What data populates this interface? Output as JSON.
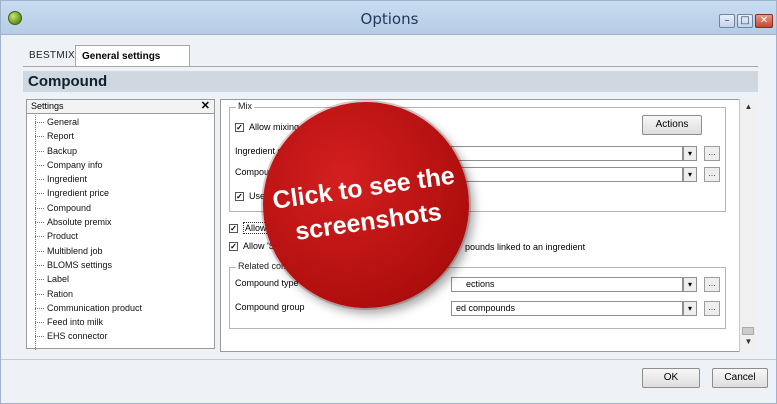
{
  "window": {
    "title": "Options"
  },
  "titlebar_buttons": {
    "minimize": "–",
    "maximize": "□",
    "close": "✕"
  },
  "tabs": [
    {
      "label": "BESTMIX"
    },
    {
      "label": "General settings"
    }
  ],
  "section_title": "Compound",
  "settings": {
    "header": "Settings",
    "close": "✕",
    "items": [
      "General",
      "Report",
      "Backup",
      "Company info",
      "Ingredient",
      "Ingredient price",
      "Compound",
      "Absolute premix",
      "Product",
      "Multiblend job",
      "BLOMS settings",
      "Label",
      "Ration",
      "Communication product",
      "Feed into milk",
      "EHS connector"
    ]
  },
  "mix": {
    "label": "Mix",
    "allow_mixing": "Allow mixing",
    "actions_button": "Actions",
    "ingredient_label": "Ingredient g",
    "compound_label": "Compound",
    "use_label": "Use",
    "combo_arrow": "▾",
    "dots": "..."
  },
  "allow_checkbox_1": "Allow",
  "allow_checkbox_2": "Allow 'S",
  "allow_checkbox_2_tail": "pounds linked to an ingredient",
  "related": {
    "label": "Related com",
    "compound_type_label": "Compound type",
    "compound_type_value": "ections",
    "compound_group_label": "Compound group",
    "compound_group_value": "ed compounds"
  },
  "overlay": {
    "line1": "Click to see the",
    "line2": "screenshots"
  },
  "footer": {
    "ok": "OK",
    "cancel": "Cancel"
  },
  "scrollbar": {
    "up": "▲",
    "down": "▼"
  }
}
